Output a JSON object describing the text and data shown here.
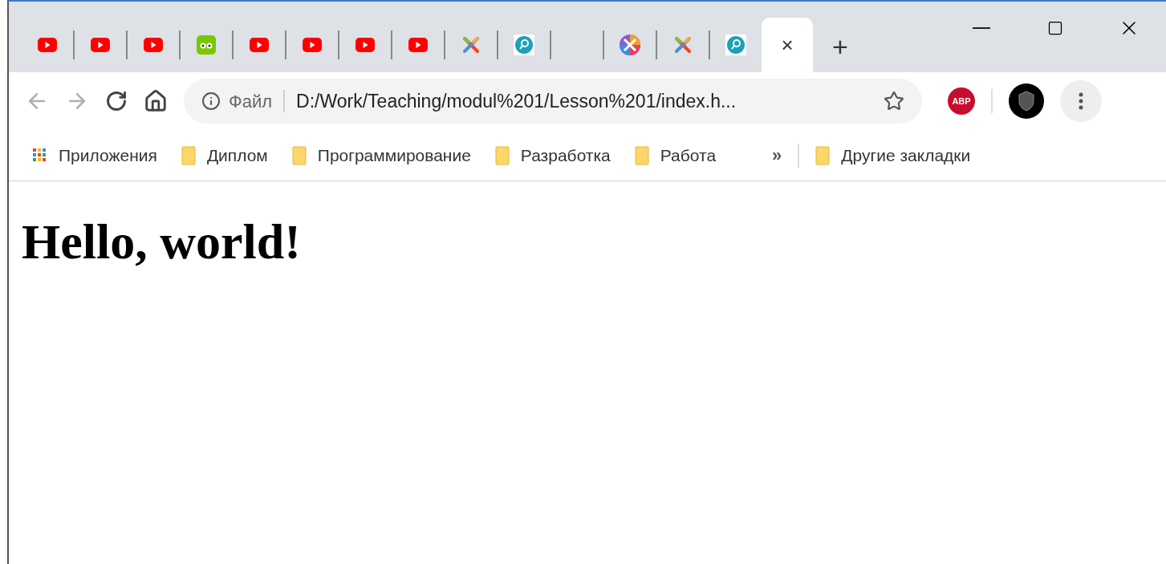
{
  "tabs": [
    {
      "kind": "youtube",
      "selected": false
    },
    {
      "kind": "youtube",
      "selected": false
    },
    {
      "kind": "youtube",
      "selected": false
    },
    {
      "kind": "owl",
      "selected": false
    },
    {
      "kind": "youtube",
      "selected": false
    },
    {
      "kind": "youtube",
      "selected": false
    },
    {
      "kind": "youtube",
      "selected": false
    },
    {
      "kind": "youtube",
      "selected": false
    },
    {
      "kind": "joomla",
      "selected": false
    },
    {
      "kind": "disc",
      "selected": false
    },
    {
      "kind": "blank"
    },
    {
      "kind": "wheel",
      "selected": false
    },
    {
      "kind": "joomla",
      "selected": false
    },
    {
      "kind": "disc",
      "selected": false
    },
    {
      "kind": "blank",
      "selected": true,
      "close": "×"
    }
  ],
  "new_tab": "+",
  "address_bar": {
    "scheme": "Файл",
    "url": "D:/Work/Teaching/modul%201/Lesson%201/index.h..."
  },
  "extension_badge": "ABP",
  "bookmarks": [
    {
      "kind": "apps",
      "label": "Приложения"
    },
    {
      "kind": "folder",
      "label": "Диплом"
    },
    {
      "kind": "folder",
      "label": "Программирование"
    },
    {
      "kind": "folder",
      "label": "Разработка"
    },
    {
      "kind": "folder",
      "label": "Работа"
    }
  ],
  "bookmarks_overflow": "»",
  "other_bookmarks": {
    "kind": "folder",
    "label": "Другие закладки"
  },
  "page": {
    "heading": "Hello, world!"
  }
}
